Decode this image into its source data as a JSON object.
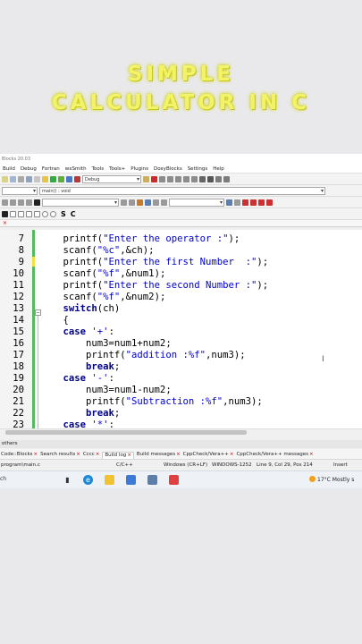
{
  "overlay": {
    "line1": "SIMPLE",
    "line2": "CALCULATOR IN C"
  },
  "ide": {
    "title": "Blocks 20.03",
    "menu": [
      "Build",
      "Debug",
      "Fortran",
      "wxSmith",
      "Tools",
      "Tools+",
      "Plugins",
      "DoxyBlocks",
      "Settings",
      "Help"
    ],
    "build_target": "Debug",
    "scope_value": "main() : void",
    "tab_close": "×",
    "search_icons": [
      "S",
      "C"
    ]
  },
  "editor": {
    "lines": [
      {
        "n": "7",
        "parts": [
          {
            "t": "    printf("
          },
          {
            "t": "\"Enter the operator :\"",
            "c": "s"
          },
          {
            "t": ");"
          }
        ]
      },
      {
        "n": "8",
        "parts": [
          {
            "t": "    scanf("
          },
          {
            "t": "\"%c\"",
            "c": "s"
          },
          {
            "t": ",&ch);"
          }
        ]
      },
      {
        "n": "9",
        "parts": [
          {
            "t": "    printf("
          },
          {
            "t": "\"Enter the first Number  :\"",
            "c": "s"
          },
          {
            "t": ");"
          }
        ]
      },
      {
        "n": "10",
        "parts": [
          {
            "t": "    scanf("
          },
          {
            "t": "\"%f\"",
            "c": "s"
          },
          {
            "t": ",&num1);"
          }
        ]
      },
      {
        "n": "11",
        "parts": [
          {
            "t": "    printf("
          },
          {
            "t": "\"Enter the second Number :\"",
            "c": "s"
          },
          {
            "t": ");"
          }
        ]
      },
      {
        "n": "12",
        "parts": [
          {
            "t": "    scanf("
          },
          {
            "t": "\"%f\"",
            "c": "s"
          },
          {
            "t": ",&num2);"
          }
        ]
      },
      {
        "n": "13",
        "parts": [
          {
            "t": "    "
          },
          {
            "t": "switch",
            "c": "kw"
          },
          {
            "t": "(ch)"
          }
        ]
      },
      {
        "n": "14",
        "parts": [
          {
            "t": "    {"
          }
        ]
      },
      {
        "n": "15",
        "parts": [
          {
            "t": "    "
          },
          {
            "t": "case",
            "c": "kw"
          },
          {
            "t": " "
          },
          {
            "t": "'+'",
            "c": "s"
          },
          {
            "t": ":"
          }
        ]
      },
      {
        "n": "16",
        "parts": [
          {
            "t": "        num3=num1+num2;"
          }
        ]
      },
      {
        "n": "17",
        "parts": [
          {
            "t": "        printf("
          },
          {
            "t": "\"addition :%f\"",
            "c": "s"
          },
          {
            "t": ",num3);"
          }
        ]
      },
      {
        "n": "18",
        "parts": [
          {
            "t": "        "
          },
          {
            "t": "break",
            "c": "kw"
          },
          {
            "t": ";"
          }
        ]
      },
      {
        "n": "19",
        "parts": [
          {
            "t": "    "
          },
          {
            "t": "case",
            "c": "kw"
          },
          {
            "t": " "
          },
          {
            "t": "'-'",
            "c": "s"
          },
          {
            "t": ":"
          }
        ]
      },
      {
        "n": "20",
        "parts": [
          {
            "t": "        num3=num1-num2;"
          }
        ]
      },
      {
        "n": "21",
        "parts": [
          {
            "t": "        printf("
          },
          {
            "t": "\"Subtraction :%f\"",
            "c": "s"
          },
          {
            "t": ",num3);"
          }
        ]
      },
      {
        "n": "22",
        "parts": [
          {
            "t": "        "
          },
          {
            "t": "break",
            "c": "kw"
          },
          {
            "t": ";"
          }
        ]
      },
      {
        "n": "23",
        "parts": [
          {
            "t": "    "
          },
          {
            "t": "case",
            "c": "kw"
          },
          {
            "t": " "
          },
          {
            "t": "'*'",
            "c": "s"
          },
          {
            "t": ":"
          }
        ]
      }
    ]
  },
  "panel": {
    "header": "others",
    "tabs": [
      {
        "label": "Code::Blocks",
        "close": "×"
      },
      {
        "label": "Search results",
        "close": "×"
      },
      {
        "label": "Cccc",
        "close": "×"
      },
      {
        "label": "Build log",
        "close": "×",
        "active": true
      },
      {
        "label": "Build messages",
        "close": "×"
      },
      {
        "label": "CppCheck/Vera++",
        "close": "×"
      },
      {
        "label": "CppCheck/Vera++ messages",
        "close": "×"
      }
    ]
  },
  "status": {
    "file": "program\\main.c",
    "lang": "C/C++",
    "eol": "Windows (CR+LF)",
    "encoding": "WINDOWS-1252",
    "position": "Line 9, Col 29, Pos 214",
    "mode": "Insert"
  },
  "taskbar": {
    "search_label": "ch",
    "temperature": "17°C",
    "weather": "Mostly s"
  },
  "colors": {
    "string": "#0000cc",
    "keyword": "#00008b",
    "gutter_green": "#56b85f",
    "title_glow": "#f3f36a"
  }
}
